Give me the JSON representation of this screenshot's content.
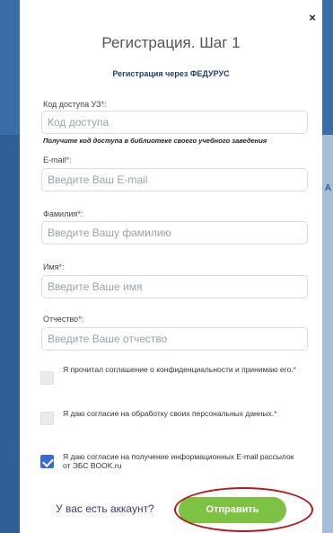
{
  "modal": {
    "close_symbol": "×",
    "title": "Регистрация. Шаг 1",
    "subtitle": "Регистрация через ФЕДУРУС"
  },
  "form": {
    "access_code": {
      "label": "Код доступа УЗ",
      "required_mark": "*:",
      "placeholder": "Код доступа",
      "hint": "Получите код доступа в библиотеке своего учебного заведения"
    },
    "email": {
      "label": "E-mail",
      "required_mark": "*:",
      "placeholder": "Введите Ваш E-mail"
    },
    "last_name": {
      "label": "Фамилия",
      "required_mark": "*:",
      "placeholder": "Введите Вашу фамилию"
    },
    "first_name": {
      "label": "Имя",
      "required_mark": "*:",
      "placeholder": "Введите Ваше имя"
    },
    "middle_name": {
      "label": "Отчество",
      "required_mark": "*:",
      "placeholder": "Введите Ваше отчество"
    }
  },
  "checkboxes": [
    {
      "text": "Я прочитал соглашение о конфиденциальности и принимаю его.",
      "required_mark": "*",
      "checked": false
    },
    {
      "text": "Я даю согласие на обработку своих персональных данных.",
      "required_mark": "*",
      "checked": false
    },
    {
      "text": "Я даю согласие на получение информационных E-mail рассылок от ЭБС BOOK.ru",
      "required_mark": "",
      "checked": true
    }
  ],
  "footer": {
    "account_link": "У вас есть аккаунт?",
    "submit_label": "Отправить"
  },
  "background": {
    "edge_text": "А"
  },
  "colors": {
    "accent_blue": "#3a6ea8",
    "submit_green": "#7dc243",
    "required_red": "#d7262e",
    "annotation_red": "#b51a1a"
  }
}
